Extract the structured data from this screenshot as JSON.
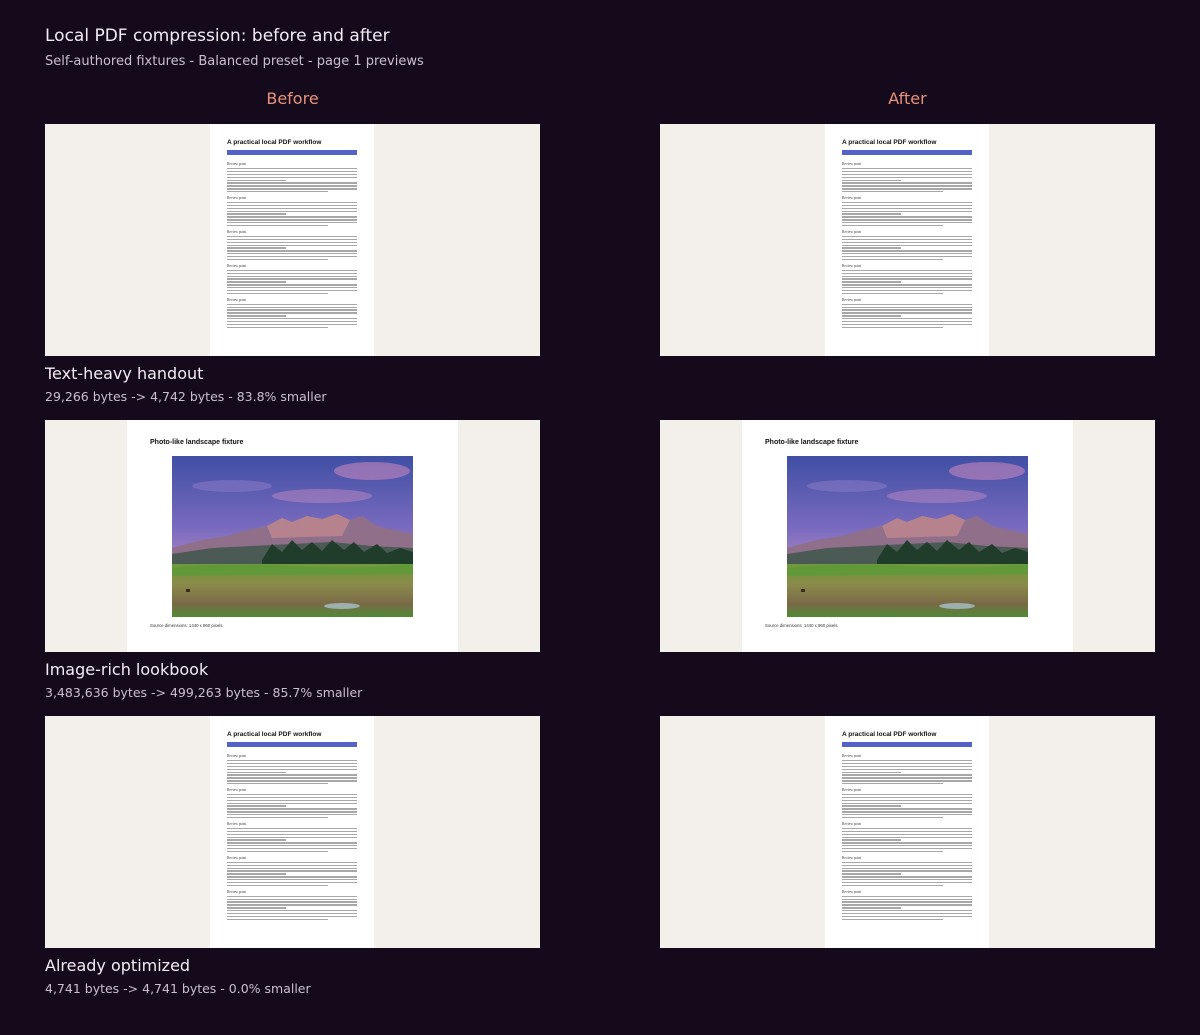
{
  "header": {
    "title": "Local PDF compression: before and after",
    "subtitle": "Self-authored fixtures - Balanced preset - page 1 previews"
  },
  "columns": {
    "before": "Before",
    "after": "After"
  },
  "fixtures": [
    {
      "name": "Text-heavy handout",
      "stats": "29,266 bytes -> 4,742 bytes - 83.8% smaller",
      "doc_title": "A practical local PDF workflow",
      "section_heading": "Review point"
    },
    {
      "name": "Image-rich lookbook",
      "stats": "3,483,636 bytes -> 499,263 bytes - 85.7% smaller",
      "doc_title": "Photo-like landscape fixture",
      "caption": "Source dimensions: 1440 x 960 pixels."
    },
    {
      "name": "Already optimized",
      "stats": "4,741 bytes -> 4,741 bytes - 0.0% smaller",
      "doc_title": "A practical local PDF workflow",
      "section_heading": "Review point"
    }
  ],
  "colors": {
    "background": "#150a1c",
    "accent_heading": "#e8917a",
    "doc_bar": "#5262c9"
  }
}
